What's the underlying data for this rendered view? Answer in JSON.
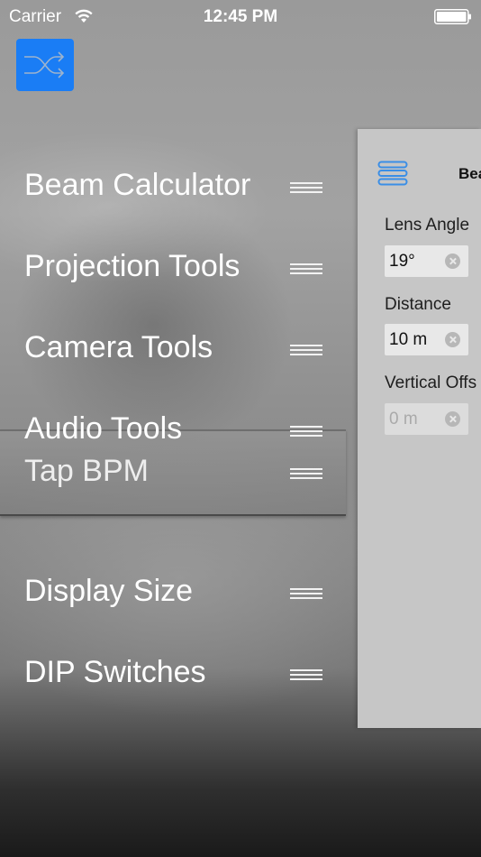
{
  "status_bar": {
    "carrier": "Carrier",
    "time": "12:45 PM",
    "wifi_icon": "wifi-icon",
    "battery_icon": "battery-icon"
  },
  "shuffle_button": {
    "icon": "shuffle-icon",
    "color": "#1a7df5"
  },
  "menu": {
    "items": [
      {
        "label": "Beam Calculator",
        "icon": "drag-handle-icon"
      },
      {
        "label": "Projection Tools",
        "icon": "drag-handle-icon"
      },
      {
        "label": "Camera Tools",
        "icon": "drag-handle-icon"
      },
      {
        "label": "Audio Tools",
        "icon": "drag-handle-icon"
      }
    ],
    "submenu": [
      {
        "label": "Tap BPM",
        "icon": "drag-handle-icon"
      }
    ],
    "items_lower": [
      {
        "label": "Display Size",
        "icon": "drag-handle-icon"
      },
      {
        "label": "DIP Switches",
        "icon": "drag-handle-icon"
      }
    ]
  },
  "panel": {
    "title": "Bea",
    "list_icon": "list-icon",
    "accent": "#3a8ee6",
    "fields": [
      {
        "label": "Lens Angle",
        "value": "19°",
        "disabled": false
      },
      {
        "label": "Distance",
        "value": "10 m",
        "disabled": false
      },
      {
        "label": "Vertical Offs",
        "value": "0 m",
        "disabled": true
      }
    ]
  }
}
